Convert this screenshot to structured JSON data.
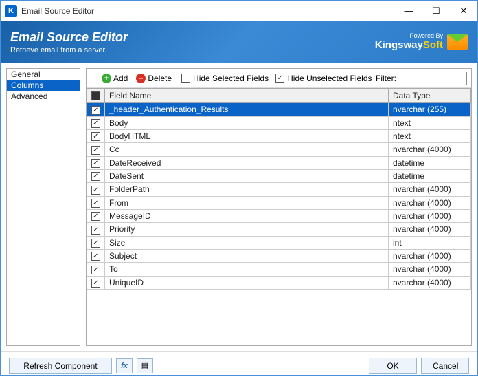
{
  "window": {
    "title": "Email Source Editor"
  },
  "header": {
    "title": "Email Source Editor",
    "subtitle": "Retrieve email from a server.",
    "powered": "Powered By",
    "brand_a": "K",
    "brand_b": "ingsway",
    "brand_c": "Soft"
  },
  "sidebar": {
    "items": [
      {
        "label": "General",
        "selected": false
      },
      {
        "label": "Columns",
        "selected": true
      },
      {
        "label": "Advanced",
        "selected": false
      }
    ]
  },
  "toolbar": {
    "add_label": "Add",
    "delete_label": "Delete",
    "hide_selected_label": "Hide Selected Fields",
    "hide_selected_checked": false,
    "hide_unselected_label": "Hide Unselected Fields",
    "hide_unselected_checked": true,
    "filter_label": "Filter:",
    "filter_value": ""
  },
  "grid": {
    "col_check": "",
    "col_field": "Field Name",
    "col_type": "Data Type",
    "rows": [
      {
        "checked": true,
        "field": "_header_Authentication_Results",
        "type": "nvarchar (255)",
        "selected": true
      },
      {
        "checked": true,
        "field": "Body",
        "type": "ntext",
        "selected": false
      },
      {
        "checked": true,
        "field": "BodyHTML",
        "type": "ntext",
        "selected": false
      },
      {
        "checked": true,
        "field": "Cc",
        "type": "nvarchar (4000)",
        "selected": false
      },
      {
        "checked": true,
        "field": "DateReceived",
        "type": "datetime",
        "selected": false
      },
      {
        "checked": true,
        "field": "DateSent",
        "type": "datetime",
        "selected": false
      },
      {
        "checked": true,
        "field": "FolderPath",
        "type": "nvarchar (4000)",
        "selected": false
      },
      {
        "checked": true,
        "field": "From",
        "type": "nvarchar (4000)",
        "selected": false
      },
      {
        "checked": true,
        "field": "MessageID",
        "type": "nvarchar (4000)",
        "selected": false
      },
      {
        "checked": true,
        "field": "Priority",
        "type": "nvarchar (4000)",
        "selected": false
      },
      {
        "checked": true,
        "field": "Size",
        "type": "int",
        "selected": false
      },
      {
        "checked": true,
        "field": "Subject",
        "type": "nvarchar (4000)",
        "selected": false
      },
      {
        "checked": true,
        "field": "To",
        "type": "nvarchar (4000)",
        "selected": false
      },
      {
        "checked": true,
        "field": "UniqueID",
        "type": "nvarchar (4000)",
        "selected": false
      }
    ]
  },
  "footer": {
    "refresh_label": "Refresh Component",
    "ok_label": "OK",
    "cancel_label": "Cancel"
  }
}
